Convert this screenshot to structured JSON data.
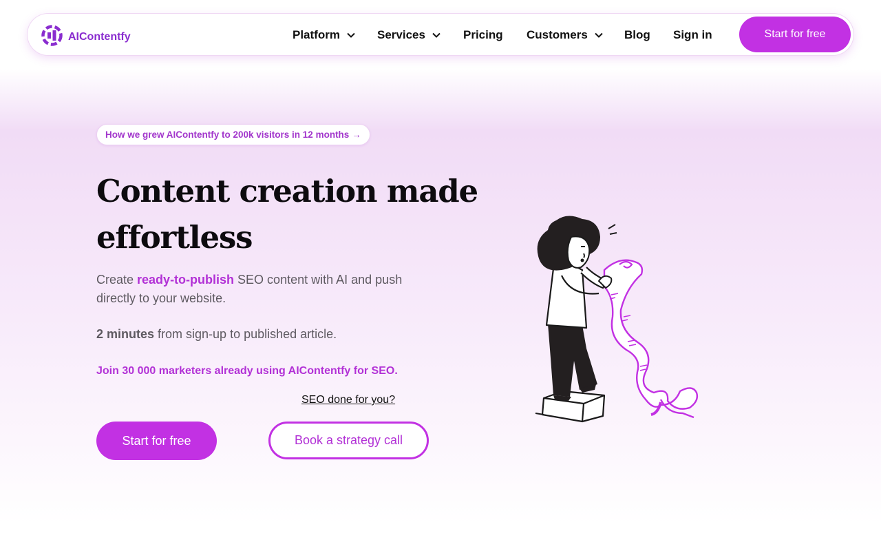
{
  "colors": {
    "brand": "#c231e3",
    "brand_text": "#b231d6",
    "logo_text": "#8a2dcf",
    "page_gradient_top": "#f1dcf6"
  },
  "header": {
    "logo_icon": "aicontentfy-logo-icon",
    "logo_text": "AIContentfy",
    "nav": [
      {
        "label": "Platform",
        "has_dropdown": true
      },
      {
        "label": "Services",
        "has_dropdown": true
      },
      {
        "label": "Pricing",
        "has_dropdown": false
      },
      {
        "label": "Customers",
        "has_dropdown": true
      },
      {
        "label": "Blog",
        "has_dropdown": false
      },
      {
        "label": "Sign in",
        "has_dropdown": false
      }
    ],
    "cta_label": "Start for free"
  },
  "hero": {
    "announcement": "How we grew AIContentfy to 200k visitors in 12 months →",
    "headline": "Content creation made effortless",
    "desc_before": "Create ",
    "desc_highlight": "ready-to-publish",
    "desc_after": " SEO content with AI and push directly to your website.",
    "minutes_bold": "2 minutes",
    "minutes_rest": " from sign-up to published article.",
    "join_text": "Join 30 000 marketers already using AIContentfy for SEO.",
    "seo_link": "SEO done for you?",
    "primary_button": "Start for free",
    "secondary_button": "Book a strategy call",
    "illustration": "woman-reading-long-scroll-illustration"
  }
}
